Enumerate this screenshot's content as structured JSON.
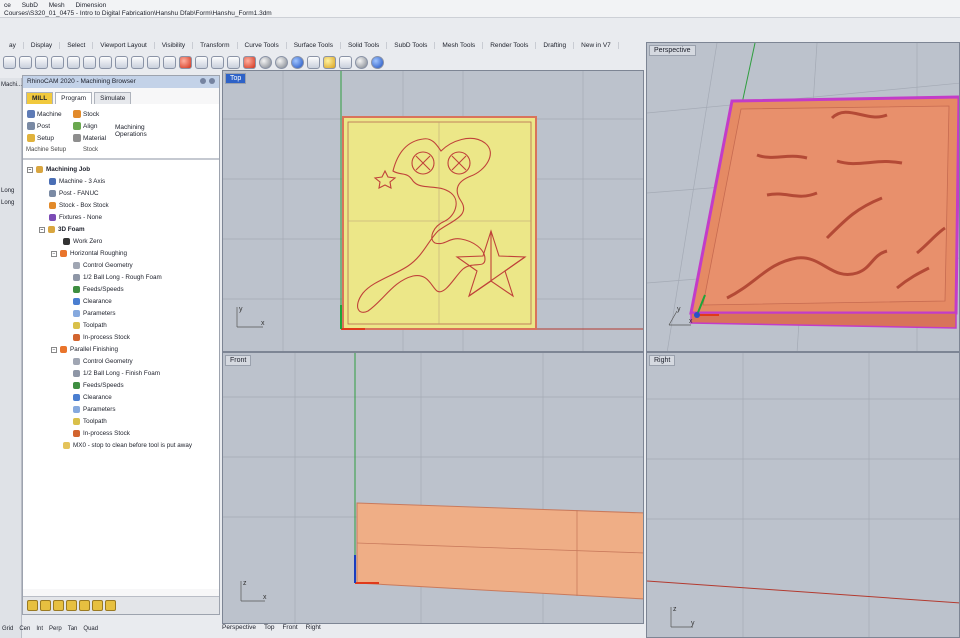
{
  "window": {
    "menus": [
      "ce",
      "SubD",
      "Mesh",
      "Dimension"
    ],
    "path": "Courses\\S320_01_0475 - Intro to Digital Fabrication\\Hanshu Dfab\\Form\\Hanshu_Form1.3dm"
  },
  "tabs": [
    "ay",
    "Display",
    "Select",
    "Viewport Layout",
    "Visibility",
    "Transform",
    "Curve Tools",
    "Surface Tools",
    "Solid Tools",
    "SubD Tools",
    "Mesh Tools",
    "Render Tools",
    "Drafting",
    "New in V7"
  ],
  "left_strip": {
    "top": "Machi...",
    "lines": [
      "Long",
      "Long"
    ]
  },
  "browser": {
    "title": "RhinoCAM 2020 - Machining Browser",
    "tabs": {
      "mill": "MILL",
      "program": "Program",
      "simulate": "Simulate"
    },
    "ribbon": {
      "machine": "Machine",
      "post": "Post",
      "setup": "Setup",
      "stock": "Stock",
      "align": "Align",
      "material": "Material",
      "machining_operations": "Machining Operations",
      "group_setup": "Machine Setup",
      "group_stock": "Stock"
    },
    "tree": [
      "Machining Job",
      "Machine - 3 Axis",
      "Post - FANUC",
      "Stock - Box Stock",
      "Fixtures - None",
      "3D Foam",
      "Work Zero",
      "Horizontal Roughing",
      "Control Geometry",
      "1/2 Ball Long - Rough Foam",
      "Feeds/Speeds",
      "Clearance",
      "Parameters",
      "Toolpath",
      "In-process Stock",
      "Parallel Finishing",
      "Control Geometry",
      "1/2 Ball Long - Finish Foam",
      "Feeds/Speeds",
      "Clearance",
      "Parameters",
      "Toolpath",
      "In-process Stock",
      "MX0 - stop to clean before tool is put away"
    ]
  },
  "viewports": {
    "top": "Top",
    "perspective": "Perspective",
    "front": "Front",
    "right": "Right"
  },
  "axis_labels": {
    "x": "x",
    "y": "y",
    "z": "z"
  },
  "viewport_tabs": [
    "Perspective",
    "Top",
    "Front",
    "Right"
  ],
  "status": [
    "Grid",
    "Cen",
    "Int",
    "Perp",
    "Tan",
    "Quad"
  ],
  "colors": {
    "stock_yellow": "#ece788",
    "stock_orange": "#e58a64",
    "magenta_box": "#c33cc8",
    "viewport_bg": "#bcc2cc",
    "curve_red": "#c0423a"
  }
}
